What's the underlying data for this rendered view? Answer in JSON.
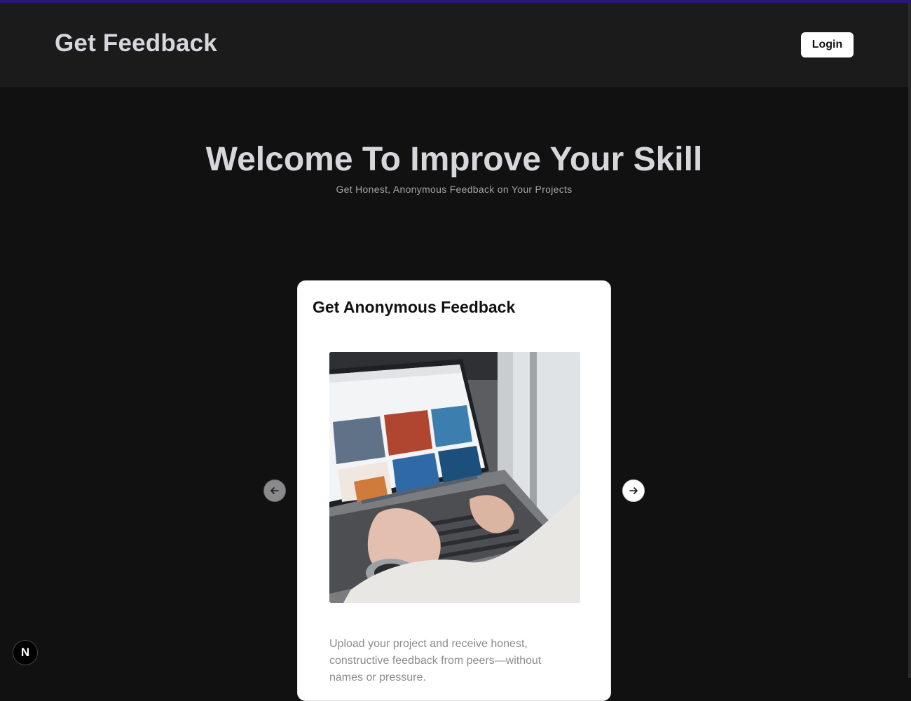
{
  "header": {
    "brand": "Get Feedback",
    "login_label": "Login"
  },
  "hero": {
    "title": "Welcome To Improve Your Skill",
    "subtitle": "Get Honest, Anonymous Feedback on Your Projects"
  },
  "carousel": {
    "prev_icon": "arrow-left-icon",
    "next_icon": "arrow-right-icon",
    "card": {
      "title": "Get Anonymous Feedback",
      "image_icon": "laptop-photo",
      "description": "Upload your project and receive honest, constructive feedback from peers—without names or pressure."
    }
  },
  "badge": {
    "letter": "N",
    "icon": "nextjs-logo-icon"
  },
  "colors": {
    "page_bg": "#111112",
    "header_bg": "#1b1b1c",
    "accent": "#2b1870",
    "title_text": "#d6d7db"
  }
}
